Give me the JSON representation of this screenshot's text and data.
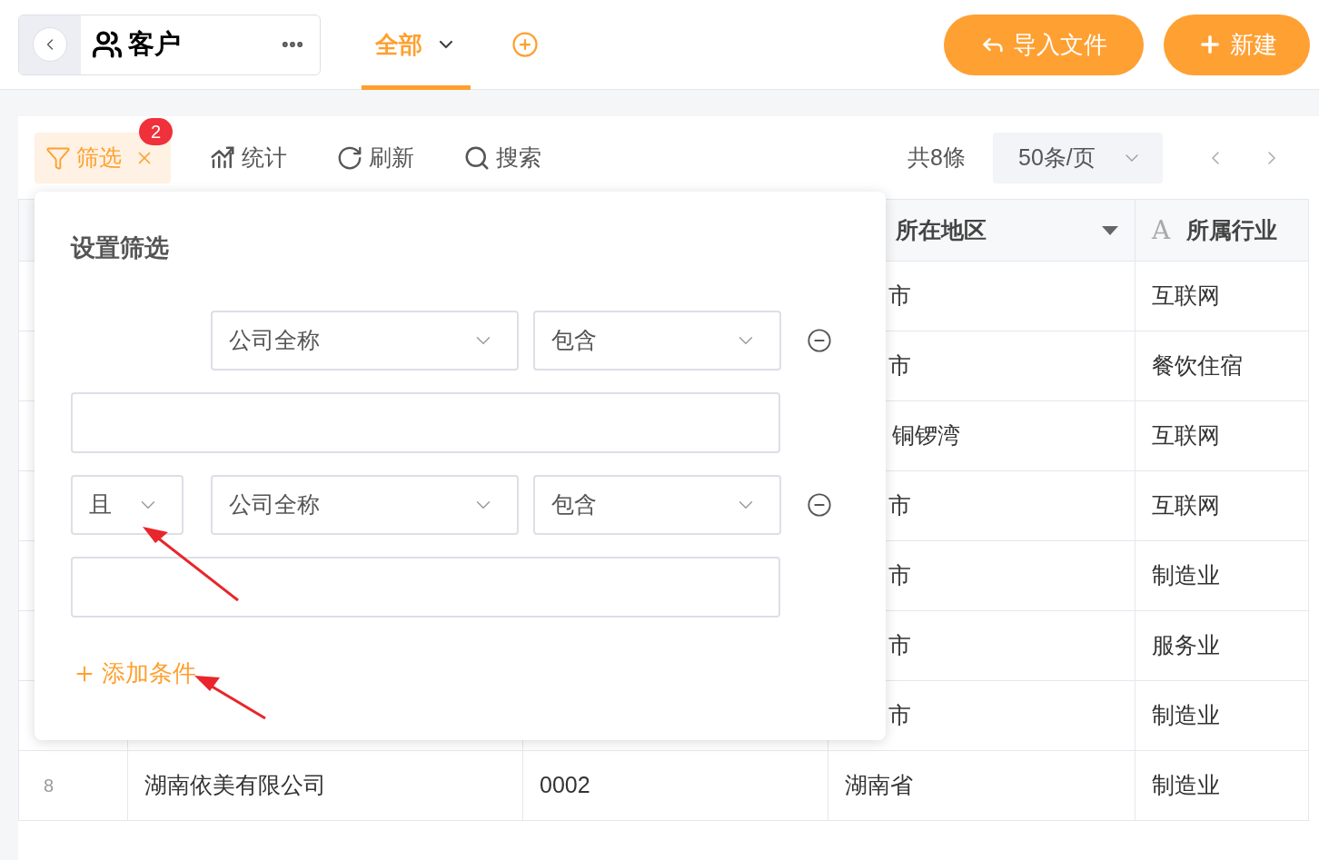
{
  "header": {
    "title": "客户",
    "views": [
      {
        "label": "全部",
        "selected": true
      }
    ],
    "buttons": [
      {
        "label": "导入文件",
        "kind": "import"
      },
      {
        "label": "新建",
        "kind": "new"
      }
    ]
  },
  "toolbar": {
    "filter": {
      "label": "筛选",
      "badge": "2",
      "active": true
    },
    "actions": [
      {
        "label": "统计",
        "kind": "stats"
      },
      {
        "label": "刷新",
        "kind": "refresh"
      },
      {
        "label": "搜索",
        "kind": "search"
      }
    ],
    "total": "共8條",
    "page_size": "50条/页"
  },
  "table": {
    "columns": [
      {
        "label": "所在地区",
        "kind": "select"
      },
      {
        "label": "所属行业",
        "kind": "text",
        "icon_glyph": "A"
      }
    ],
    "rows": [
      {
        "region": "市",
        "industry": "互联网"
      },
      {
        "region": "市",
        "industry": "餐饮住宿"
      },
      {
        "region": "铜锣湾",
        "industry": "互联网"
      },
      {
        "region": "市",
        "industry": "互联网"
      },
      {
        "region": "市",
        "industry": "制造业"
      },
      {
        "region": "市",
        "industry": "服务业"
      },
      {
        "region": "市",
        "industry": "制造业"
      },
      {
        "index": "8",
        "company": "湖南依美有限公司",
        "code": "0002",
        "region": "湖南省",
        "industry": "制造业"
      }
    ]
  },
  "filter_panel": {
    "title": "设置筛选",
    "conditions": [
      {
        "field": "公司全称",
        "operator": "包含"
      },
      {
        "conjunction": "且",
        "field": "公司全称",
        "operator": "包含"
      }
    ],
    "add_label": "添加条件"
  }
}
